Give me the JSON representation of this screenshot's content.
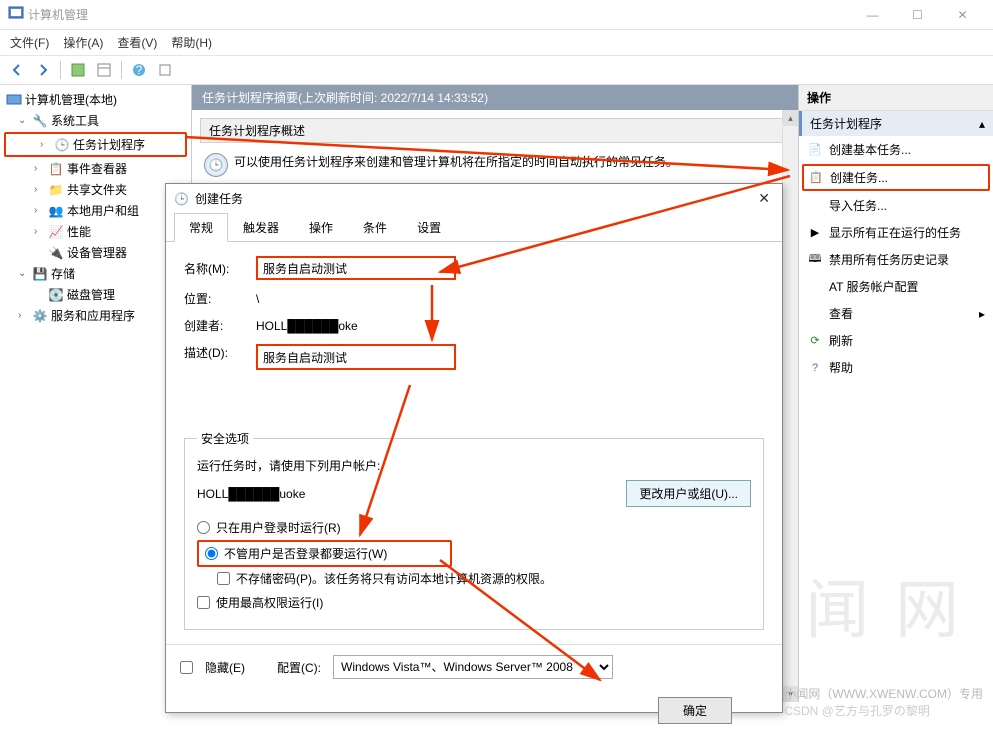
{
  "window": {
    "title": "计算机管理",
    "menus": [
      "文件(F)",
      "操作(A)",
      "查看(V)",
      "帮助(H)"
    ]
  },
  "tree": {
    "root": "计算机管理(本地)",
    "system_tools": "系统工具",
    "task_scheduler": "任务计划程序",
    "event_viewer": "事件查看器",
    "shared_folders": "共享文件夹",
    "local_users": "本地用户和组",
    "performance": "性能",
    "device_manager": "设备管理器",
    "storage": "存储",
    "disk_mgmt": "磁盘管理",
    "services_apps": "服务和应用程序"
  },
  "center": {
    "header": "任务计划程序摘要(上次刷新时间: 2022/7/14 14:33:52)",
    "section_title": "任务计划程序概述",
    "section_text": "可以使用任务计划程序来创建和管理计算机将在所指定的时间自动执行的常见任务。"
  },
  "actions": {
    "panel_title": "操作",
    "group_title": "任务计划程序",
    "create_basic": "创建基本任务...",
    "create_task": "创建任务...",
    "import_task": "导入任务...",
    "show_running": "显示所有正在运行的任务",
    "disable_history": "禁用所有任务历史记录",
    "at_service": "AT 服务帐户配置",
    "view": "查看",
    "refresh": "刷新",
    "help": "帮助"
  },
  "dialog": {
    "title": "创建任务",
    "tabs": [
      "常规",
      "触发器",
      "操作",
      "条件",
      "设置"
    ],
    "name_label": "名称(M):",
    "name_value": "服务自启动测试",
    "location_label": "位置:",
    "location_value": "\\",
    "creator_label": "创建者:",
    "creator_value": "HOLL██████oke",
    "desc_label": "描述(D):",
    "desc_value": "服务自启动测试",
    "security_legend": "安全选项",
    "security_hint": "运行任务时，请使用下列用户帐户:",
    "security_user": "HOLL██████uoke",
    "change_user_btn": "更改用户或组(U)...",
    "radio_logged_on": "只在用户登录时运行(R)",
    "radio_always": "不管用户是否登录都要运行(W)",
    "check_no_pwd": "不存储密码(P)。该任务将只有访问本地计算机资源的权限。",
    "check_highest": "使用最高权限运行(I)",
    "check_hidden": "隐藏(E)",
    "config_label": "配置(C):",
    "config_value": "Windows Vista™、Windows Server™ 2008",
    "ok_btn": "确定"
  },
  "footer": {
    "watermark_small": "小闻网（WWW.XWENW.COM）专用",
    "csdn": "CSDN @艺方与孔罗の黎明",
    "watermark_big": "小 闻 网"
  }
}
